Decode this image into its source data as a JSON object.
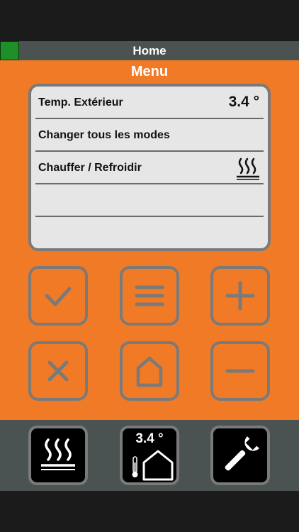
{
  "header": {
    "title": "Home",
    "status_color": "#1f8f2a"
  },
  "menu": {
    "title": "Menu",
    "rows": [
      {
        "label": "Temp. Extérieur",
        "value": "3.4 °"
      },
      {
        "label": "Changer tous les modes",
        "value": ""
      },
      {
        "label": "Chauffer / Refroidir",
        "icon": "heating-icon"
      },
      {
        "label": ""
      },
      {
        "label": ""
      }
    ]
  },
  "buttons": [
    "check-icon",
    "menu-icon",
    "plus-icon",
    "close-icon",
    "home-icon",
    "minus-icon"
  ],
  "footer": {
    "heating_icon": "heating-icon",
    "outdoor_temp": "3.4 °",
    "settings_icon": "wrench-icon"
  },
  "colors": {
    "accent": "#f07a26",
    "bar": "#4a5252",
    "button_border": "#7a7a7a"
  }
}
